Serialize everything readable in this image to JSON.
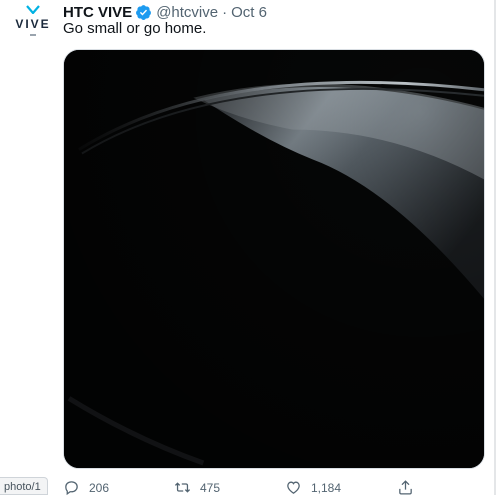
{
  "tweet": {
    "author": {
      "display_name": "HTC VIVE",
      "handle": "@htcvive",
      "separator": "·",
      "date": "Oct 6",
      "verified": true,
      "avatar_logo_text": "VIVE"
    },
    "text": "Go small or go home.",
    "media": {
      "description_icon": "photo"
    },
    "actions": {
      "reply": {
        "icon": "reply-icon",
        "count": "206"
      },
      "retweet": {
        "icon": "retweet-icon",
        "count": "475"
      },
      "like": {
        "icon": "heart-icon",
        "count": "1,184"
      },
      "share": {
        "icon": "share-icon"
      }
    }
  },
  "status_bar": {
    "url_fragment": "photo/1"
  },
  "colors": {
    "verified_blue": "#1d9bf0",
    "secondary_text": "#536471",
    "primary_text": "#0f1419",
    "vive_blue": "#00b2e3"
  }
}
